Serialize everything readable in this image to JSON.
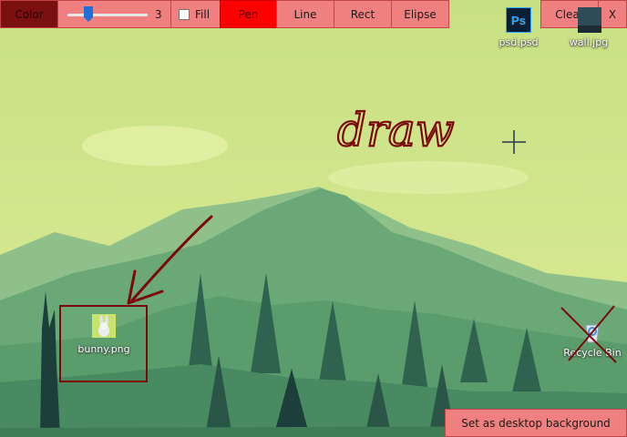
{
  "toolbar": {
    "color_label": "Color",
    "brush_size": "3",
    "fill_label": "Fill",
    "fill_checked": false,
    "tools": {
      "pen": "Pen",
      "line": "Line",
      "rect": "Rect",
      "ellipse": "Elipse"
    },
    "active_tool": "pen",
    "clear_label": "Clear",
    "close_label": "X"
  },
  "desktop_icons": {
    "psd": {
      "label": "psd.psd",
      "icon": "photoshop-icon",
      "badge": "Ps"
    },
    "wall": {
      "label": "wall.jpg",
      "icon": "image-file-icon"
    },
    "bunny": {
      "label": "bunny.png",
      "icon": "bunny-image-icon"
    },
    "recycle": {
      "label": "Recycle Bin",
      "icon": "recycle-bin-icon"
    }
  },
  "drawing": {
    "handwritten_text": "draw"
  },
  "set_background_label": "Set as desktop background",
  "colors": {
    "toolbar_button": "#f08080",
    "active_tool": "#ff0000",
    "color_swatch": "#7a1010",
    "ink": "#7a0a0a",
    "sky": "#d8ea90",
    "mountains": "#5e9e6d"
  }
}
